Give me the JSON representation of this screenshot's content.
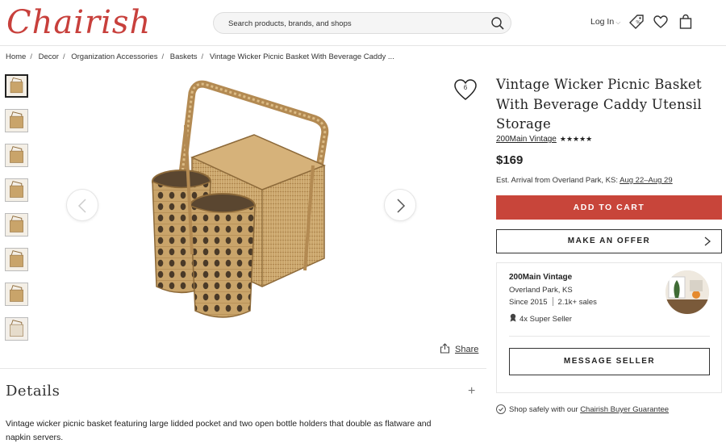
{
  "header": {
    "logo": "Chairish",
    "search_placeholder": "Search products, brands, and shops",
    "login_label": "Log In",
    "icons": [
      "search-icon",
      "tag-icon",
      "heart-icon",
      "shopping-bag-icon"
    ]
  },
  "breadcrumb": [
    "Home",
    "Decor",
    "Organization Accessories",
    "Baskets",
    "Vintage Wicker Picnic Basket With Beverage Caddy ..."
  ],
  "gallery": {
    "thumbnail_count": 8,
    "favorite_count": "6",
    "share_label": "Share"
  },
  "details": {
    "heading": "Details",
    "description": "Vintage wicker picnic basket featuring large lidded pocket and two open bottle holders that double as flatware and napkin servers."
  },
  "product": {
    "title": "Vintage Wicker Picnic Basket With Beverage Caddy Utensil Storage",
    "seller_name": "200Main Vintage",
    "rating_stars": "★★★★★",
    "price": "$169",
    "arrival_prefix": "Est. Arrival from Overland Park, KS:",
    "arrival_dates": "Aug 22–Aug 29",
    "add_to_cart": "ADD TO CART",
    "make_offer": "MAKE AN OFFER"
  },
  "seller": {
    "name": "200Main Vintage",
    "location": "Overland Park, KS",
    "since": "Since 2015",
    "sales": "2.1k+ sales",
    "badge": "4x Super Seller",
    "message_button": "MESSAGE SELLER"
  },
  "guarantee": {
    "prefix": "Shop safely with our",
    "link": "Chairish Buyer Guarantee"
  },
  "colors": {
    "brand": "#c8403c",
    "cart_button": "#c8453a",
    "wicker": "#c9a46a"
  }
}
